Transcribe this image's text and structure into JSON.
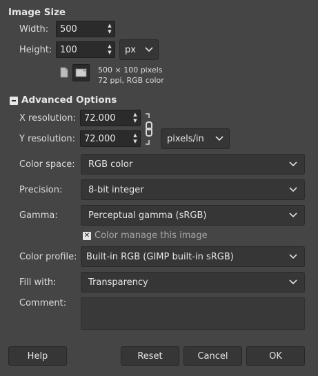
{
  "image_size": {
    "heading": "Image Size",
    "width_label": "Width:",
    "width_value": "500",
    "height_label": "Height:",
    "height_value": "100",
    "unit": "px",
    "info_dimensions": "500 × 100 pixels",
    "info_details": "72 ppi, RGB color"
  },
  "advanced": {
    "heading": "Advanced Options",
    "x_res_label": "X resolution:",
    "x_res_value": "72.000",
    "y_res_label": "Y resolution:",
    "y_res_value": "72.000",
    "res_unit": "pixels/in",
    "color_space_label": "Color space:",
    "color_space_value": "RGB color",
    "precision_label": "Precision:",
    "precision_value": "8-bit integer",
    "gamma_label": "Gamma:",
    "gamma_value": "Perceptual gamma (sRGB)",
    "color_manage_label": "Color manage this image",
    "color_manage_checked": true,
    "color_profile_label": "Color profile:",
    "color_profile_value": "Built-in RGB (GIMP built-in sRGB)",
    "fill_label": "Fill with:",
    "fill_value": "Transparency",
    "comment_label": "Comment:",
    "comment_value": ""
  },
  "buttons": {
    "help": "Help",
    "reset": "Reset",
    "cancel": "Cancel",
    "ok": "OK"
  },
  "icons": {
    "portrait": "portrait-orientation-icon",
    "landscape": "landscape-orientation-icon",
    "chain": "chain-link-icon",
    "collapse": "collapse-minus-icon",
    "check": "checkmark-icon",
    "chevron": "chevron-down-icon"
  },
  "colors": {
    "background": "#454545",
    "field": "#2b2b2b",
    "combo": "#363636"
  }
}
